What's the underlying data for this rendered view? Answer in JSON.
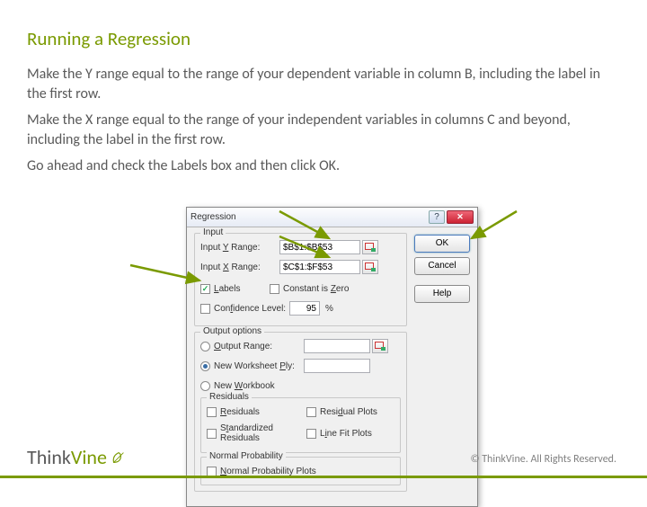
{
  "slide": {
    "title": "Running a Regression",
    "paragraphs": [
      "Make the Y range equal to the range of your dependent variable in column B, including the label in the first row.",
      "Make the X range equal to the range of your independent variables in columns C and beyond, including the label in the first row.",
      "Go ahead and check the Labels box and then click OK."
    ]
  },
  "dialog": {
    "title": "Regression",
    "buttons": {
      "ok": "OK",
      "cancel": "Cancel",
      "help": "Help"
    },
    "input": {
      "group": "Input",
      "y_label": "Input Y Range:",
      "y_value": "$B$1:$B$53",
      "x_label": "Input X Range:",
      "x_value": "$C$1:$F$53",
      "labels": "Labels",
      "labels_checked": true,
      "const_zero": "Constant is Zero",
      "conf": "Confidence Level:",
      "conf_value": "95",
      "conf_pct": "%"
    },
    "output": {
      "group": "Output options",
      "out_range": "Output Range:",
      "new_ply": "New Worksheet Ply:",
      "new_wb": "New Workbook",
      "residuals_group": "Residuals",
      "residuals": "Residuals",
      "std_residuals": "Standardized Residuals",
      "resid_plots": "Residual Plots",
      "line_fit": "Line Fit Plots",
      "np_group": "Normal Probability",
      "np_plots": "Normal Probability Plots"
    }
  },
  "footer": {
    "logo1": "Think",
    "logo2": "Vine",
    "copyright": "© ThinkVine.  All Rights Reserved."
  }
}
